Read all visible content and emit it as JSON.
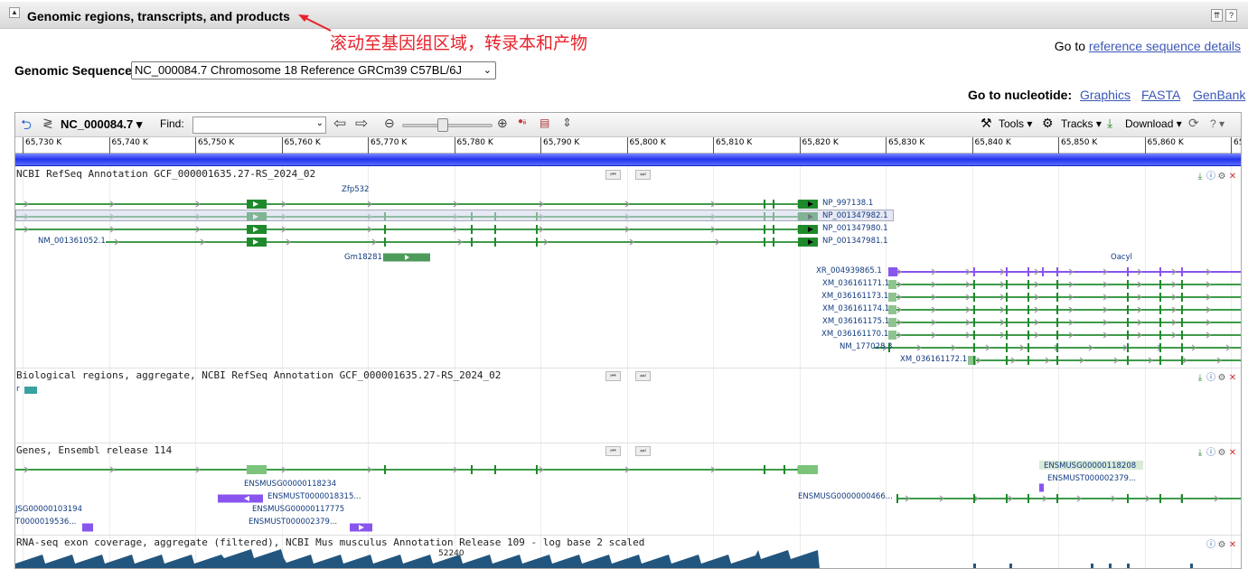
{
  "section": {
    "title": "Genomic regions, transcripts, and products",
    "annotation": "滚动至基因组区域，转录本和产物",
    "goto_ref_prefix": "Go to",
    "goto_ref_link": "reference sequence details"
  },
  "genomic_sequence": {
    "label": "Genomic Sequence:",
    "selected": "NC_000084.7 Chromosome 18 Reference GRCm39 C57BL/6J"
  },
  "goto_nucleotide": {
    "label": "Go to nucleotide:",
    "links": [
      "Graphics",
      "FASTA",
      "GenBank"
    ]
  },
  "toolbar": {
    "accession": "NC_000084.7",
    "find_label": "Find:",
    "find_value": "",
    "tools": "Tools",
    "tracks": "Tracks",
    "download": "Download"
  },
  "ruler": [
    "65,730 K",
    "65,740 K",
    "65,750 K",
    "65,760 K",
    "65,770 K",
    "65,780 K",
    "65,790 K",
    "65,800 K",
    "65,810 K",
    "65,820 K",
    "65,830 K",
    "65,840 K",
    "65,850 K",
    "65,860 K",
    "65"
  ],
  "tracks": {
    "refseq": {
      "title": "NCBI RefSeq Annotation GCF_000001635.27-RS_2024_02",
      "gene1": "Zfp532",
      "proteins": [
        "NP_997138.1",
        "NP_001347982.1",
        "NP_001347980.1",
        "NP_001347981.1"
      ],
      "nm1": "NM_001361052.1",
      "gm": "Gm18281",
      "gene2": "Oacyl",
      "transcripts2": [
        "XR_004939865.1",
        "XM_036161171.1",
        "XM_036161173.1",
        "XM_036161174.1",
        "XM_036161175.1",
        "XM_036161170.1",
        "NM_177028.3",
        "XM_036161172.1"
      ]
    },
    "bio": {
      "title": "Biological regions, aggregate, NCBI RefSeq Annotation GCF_000001635.27-RS_2024_02",
      "label": "r"
    },
    "ensembl": {
      "title": "Genes, Ensembl release 114",
      "labels": [
        "ENSMUSG00000118208",
        "ENSMUST000002379...",
        "ENSMUSG00000118234",
        "ENSMUST0000018315...",
        "ENSMUSG0000000466...",
        "JSG00000103194",
        "T0000019536...",
        "ENSMUSG00000117775",
        "ENSMUST000002379..."
      ]
    },
    "rnaseq": {
      "title": "RNA-seq exon coverage, aggregate (filtered), NCBI Mus musculus Annotation Release 109 - log base 2 scaled",
      "max": "52240"
    }
  },
  "colors": {
    "gene_green": "#3f9b4a",
    "exon_green": "#1f8a2c",
    "purple": "#8855ee",
    "annotation_red": "#e8222c",
    "link_blue": "#3a57b7"
  }
}
